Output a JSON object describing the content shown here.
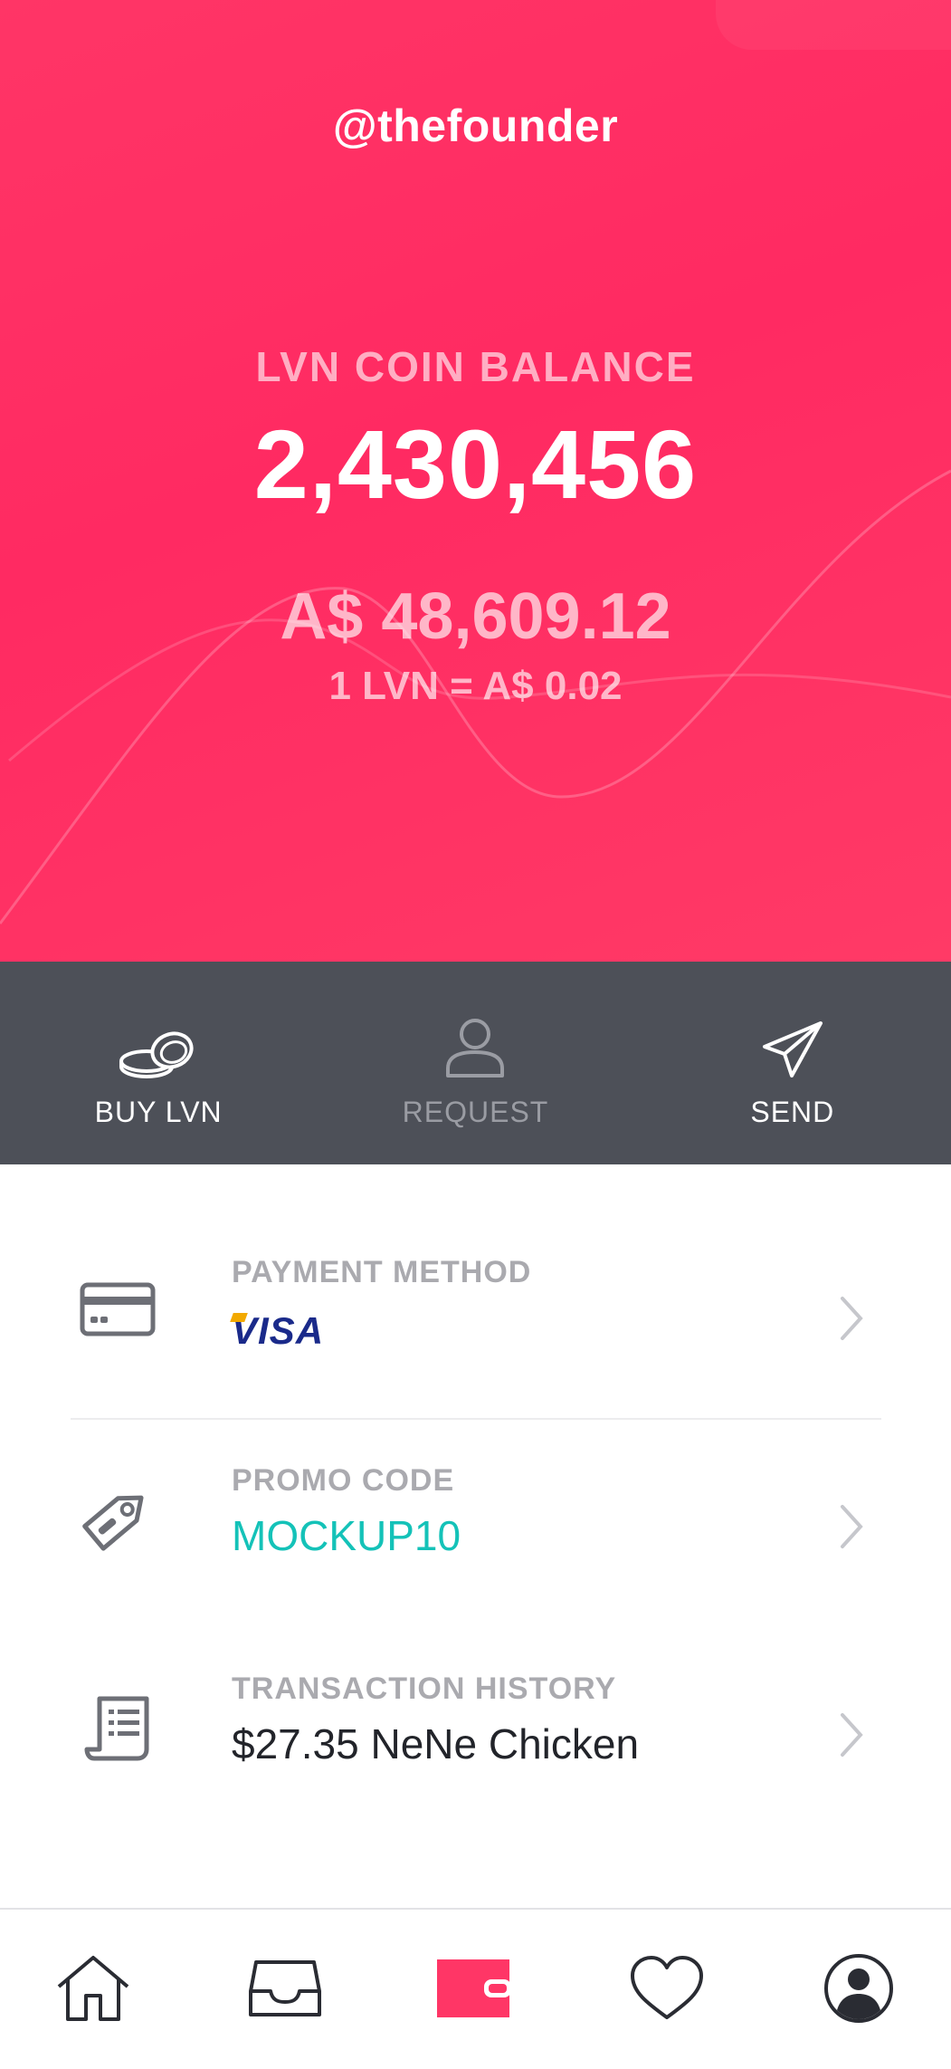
{
  "profile": {
    "username": "@thefounder"
  },
  "balance": {
    "label": "LVN COIN BALANCE",
    "coins": "2,430,456",
    "fiat": "A$ 48,609.12",
    "rate": "1 LVN = A$ 0.02"
  },
  "actions": [
    {
      "label": "BUY LVN",
      "icon": "coins-icon"
    },
    {
      "label": "REQUEST",
      "icon": "person-icon"
    },
    {
      "label": "SEND",
      "icon": "paper-plane-icon"
    }
  ],
  "rows": {
    "payment": {
      "caption": "PAYMENT METHOD",
      "value": "VISA",
      "icon": "credit-card-icon"
    },
    "promo": {
      "caption": "PROMO CODE",
      "value": "MOCKUP10",
      "icon": "tag-icon"
    },
    "history": {
      "caption": "TRANSACTION HISTORY",
      "value": "$27.35 NeNe Chicken",
      "icon": "receipt-icon"
    }
  },
  "tabbar": {
    "items": [
      "home-icon",
      "inbox-icon",
      "wallet-icon",
      "heart-icon",
      "profile-icon"
    ],
    "active": "wallet-icon"
  },
  "colors": {
    "brand": "#ff2e63",
    "actionbar": "#4d5058",
    "promo": "#14c2b8"
  }
}
